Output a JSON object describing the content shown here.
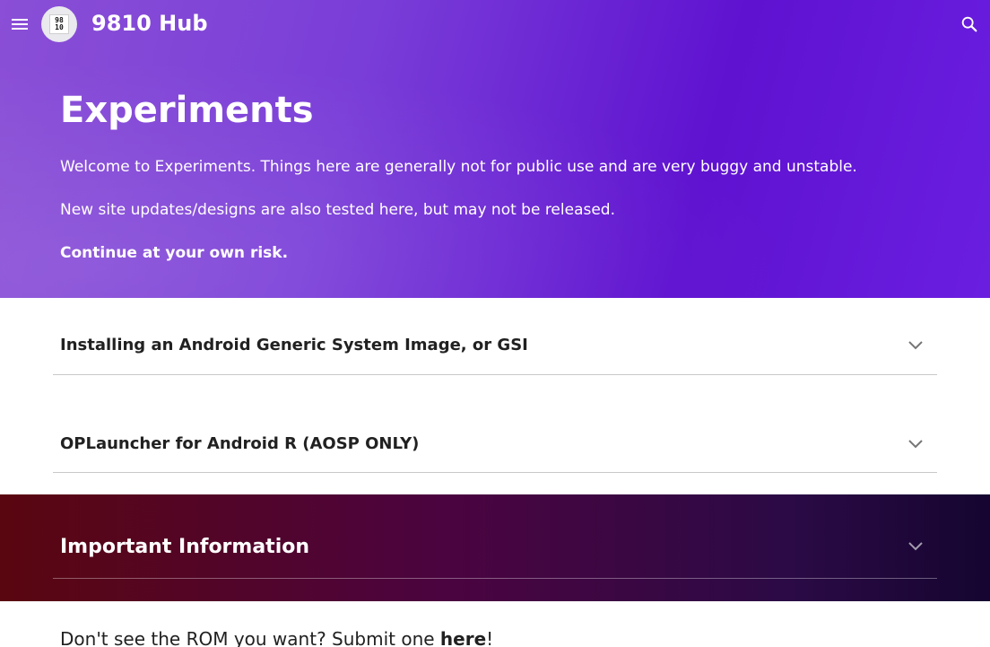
{
  "header": {
    "site_title": "9810 Hub",
    "logo_text_top": "98",
    "logo_text_bottom": "10",
    "menu_icon": "hamburger-menu-icon",
    "search_icon": "search-icon"
  },
  "hero": {
    "title": "Experiments",
    "paragraph_1": "Welcome to Experiments. Things here are generally not for public use and are very buggy and unstable.",
    "paragraph_2": "New site updates/designs are also tested here, but may not be released.",
    "paragraph_3": "Continue at your own risk."
  },
  "accordions": [
    {
      "title": "Installing an Android Generic System Image, or GSI",
      "icon": "chevron-down-icon"
    },
    {
      "title": "OPLauncher for Android R (AOSP ONLY)",
      "icon": "chevron-down-icon"
    }
  ],
  "important_section": {
    "title": "Important Information",
    "icon": "chevron-down-icon"
  },
  "footer_prompt": {
    "text_before": "Don't see the ROM you want? Submit one ",
    "link_text": "here",
    "text_after": "!"
  }
}
